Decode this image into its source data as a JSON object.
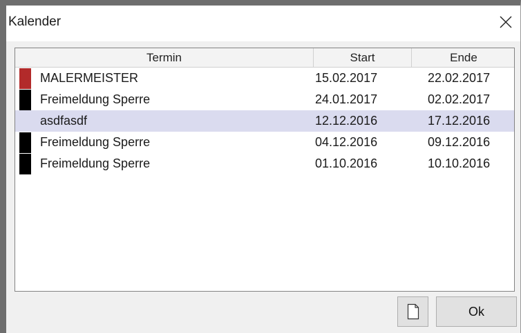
{
  "window": {
    "title": "Kalender",
    "close_icon": "close-icon"
  },
  "table": {
    "columns": [
      "Termin",
      "Start",
      "Ende"
    ],
    "rows": [
      {
        "name": "MALERMEISTER",
        "start": "15.02.2017",
        "end": "22.02.2017",
        "color": "#b22a2a",
        "selected": false
      },
      {
        "name": "Freimeldung Sperre",
        "start": "24.01.2017",
        "end": "02.02.2017",
        "color": "#000000",
        "selected": false
      },
      {
        "name": "asdfasdf",
        "start": "12.12.2016",
        "end": "17.12.2016",
        "color": null,
        "selected": true
      },
      {
        "name": "Freimeldung Sperre",
        "start": "04.12.2016",
        "end": "09.12.2016",
        "color": "#000000",
        "selected": false
      },
      {
        "name": "Freimeldung Sperre",
        "start": "01.10.2016",
        "end": "10.10.2016",
        "color": "#000000",
        "selected": false
      }
    ]
  },
  "buttons": {
    "new_icon": "new-document-icon",
    "ok_label": "Ok"
  },
  "colors": {
    "selection": "#dadbef",
    "window_frame": "#6e6e6e"
  }
}
